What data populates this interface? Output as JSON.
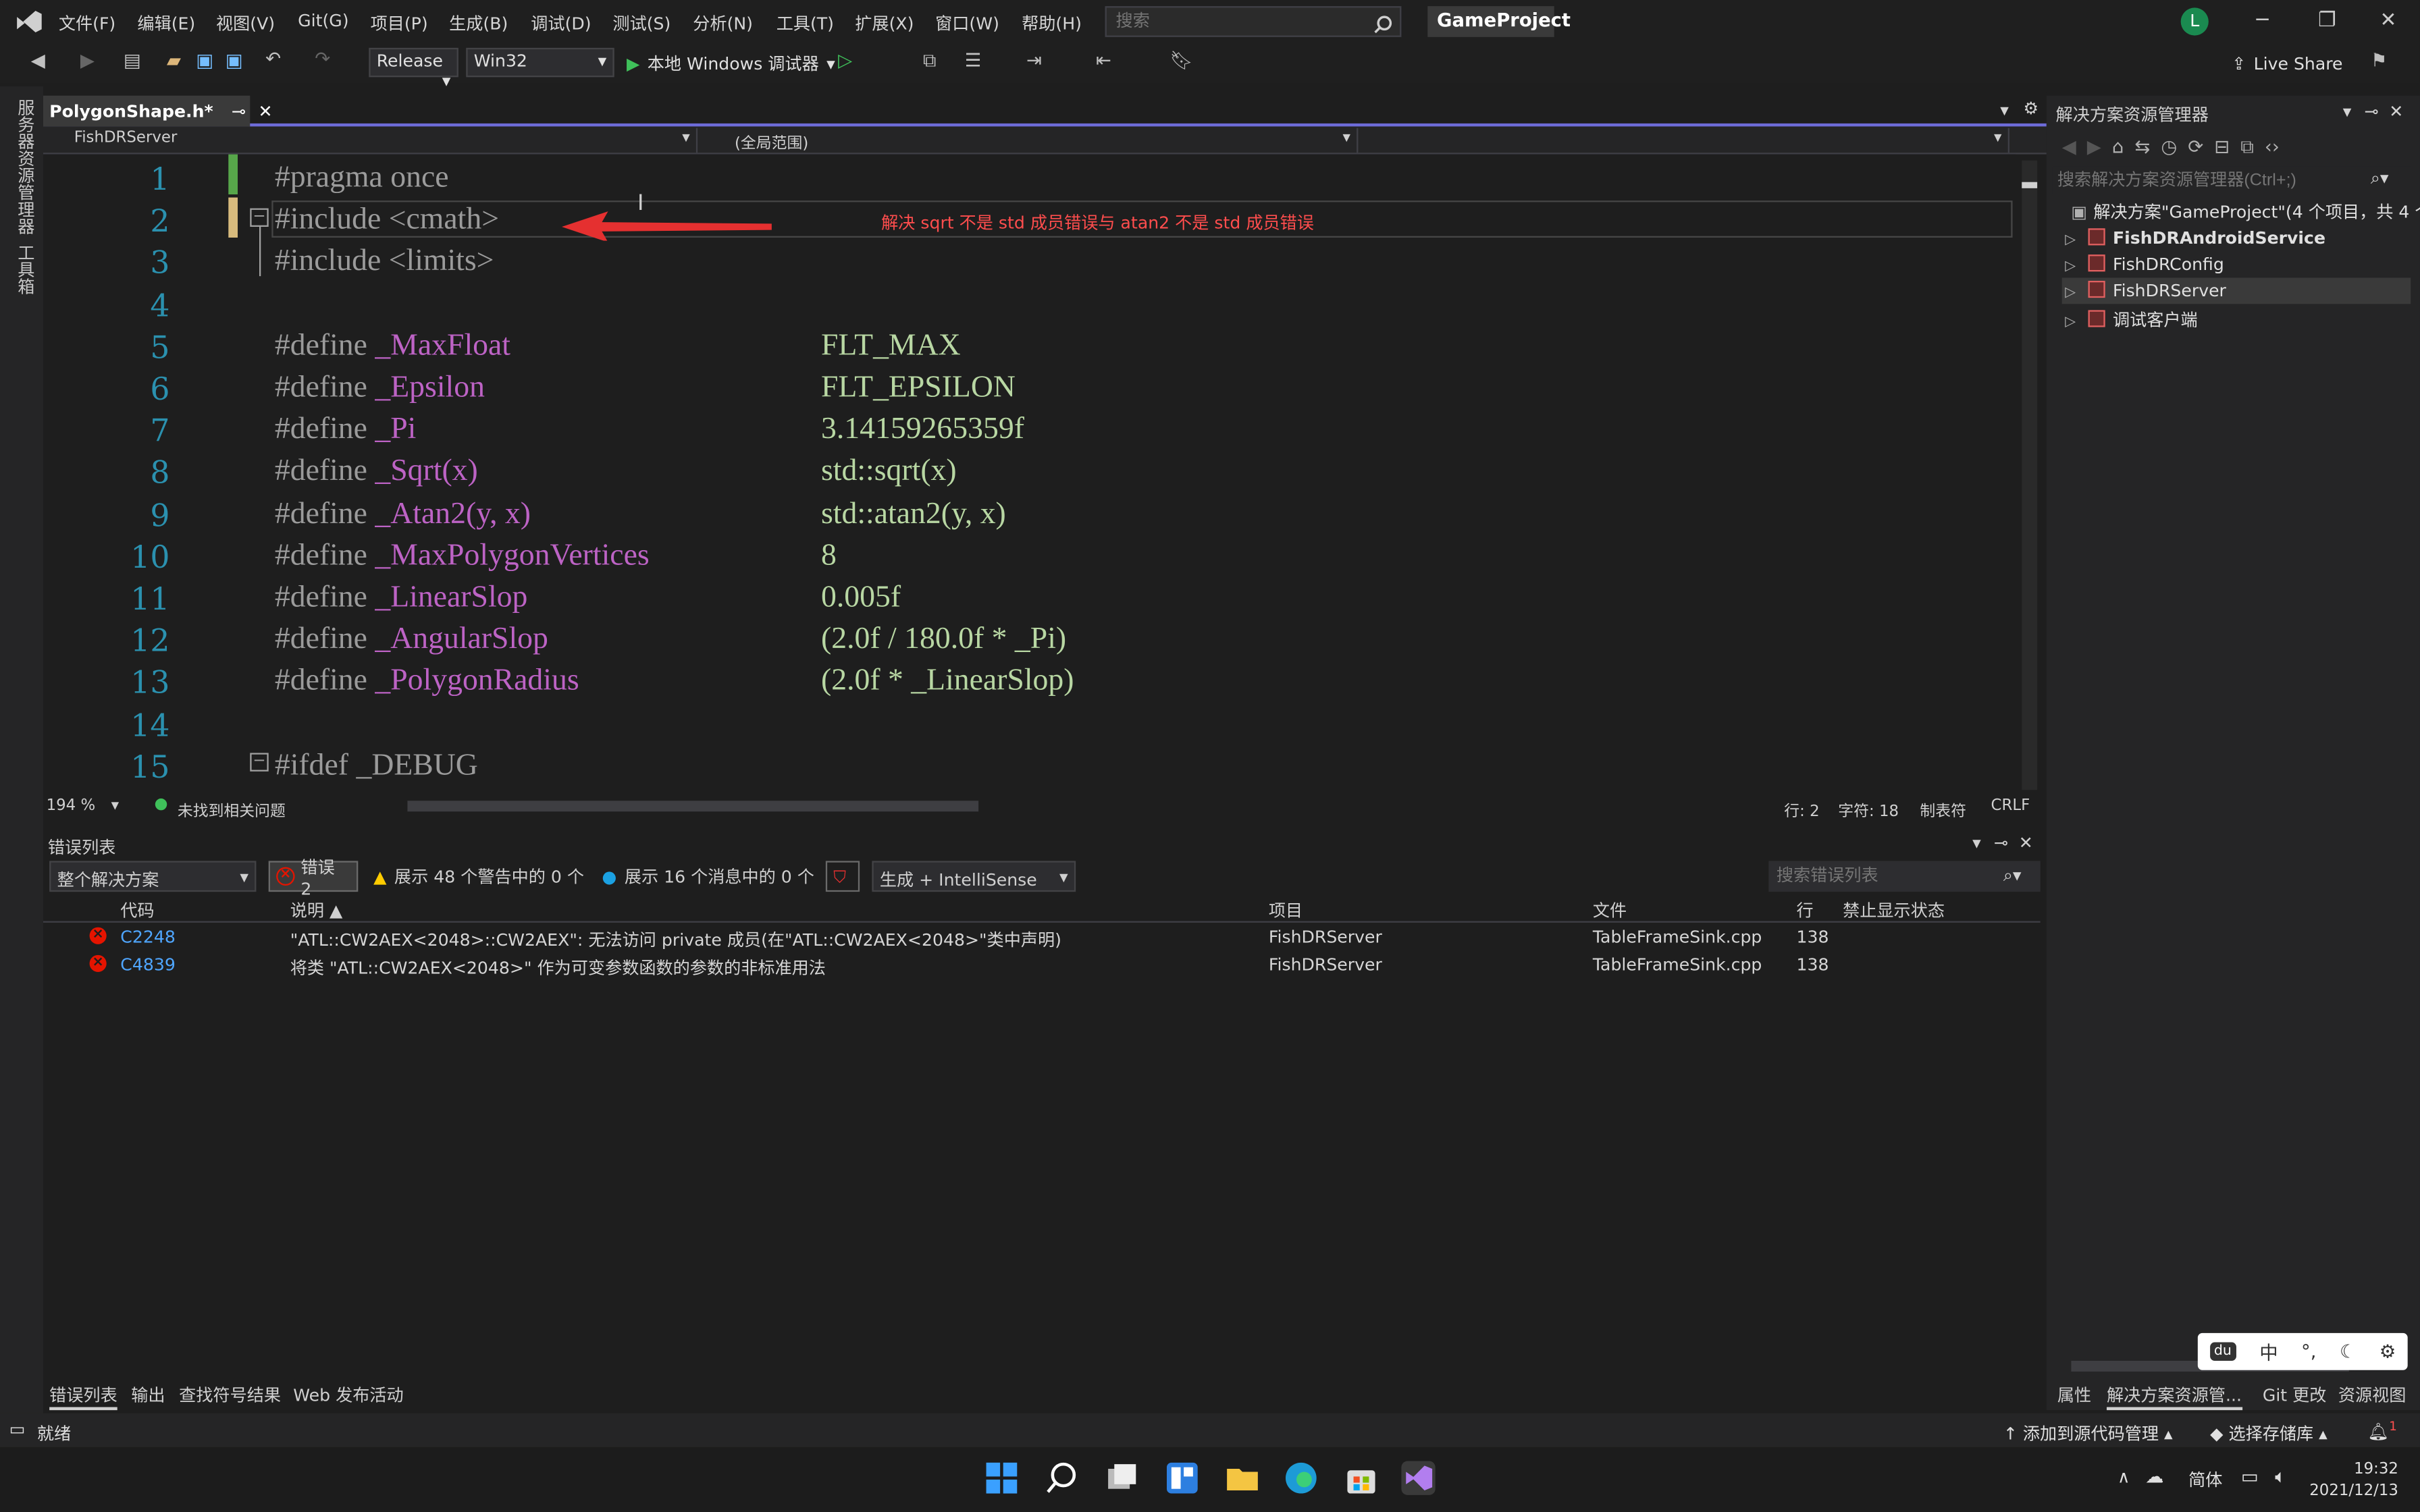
{
  "menu": [
    "文件(F)",
    "编辑(E)",
    "视图(V)",
    "Git(G)",
    "项目(P)",
    "生成(B)",
    "调试(D)",
    "测试(S)",
    "分析(N)",
    "工具(T)",
    "扩展(X)",
    "窗口(W)",
    "帮助(H)"
  ],
  "search_placeholder": "搜索",
  "project_name": "GameProject",
  "avatar_letter": "L",
  "toolbar": {
    "config": "Release",
    "platform": "Win32",
    "debugger": "本地 Windows 调试器",
    "live_share": "Live Share"
  },
  "left_rail": [
    "服务器资源管理器",
    "工具箱"
  ],
  "editor": {
    "tab_title": "PolygonShape.h*",
    "nav_project": "FishDRServer",
    "nav_scope": "(全局范围)",
    "annotation": "解决 sqrt 不是 std 成员错误与 atan2 不是 std 成员错误",
    "lines": [
      {
        "n": "1",
        "a": "#pragma once",
        "b": ""
      },
      {
        "n": "2",
        "a": "#include <cmath>",
        "b": ""
      },
      {
        "n": "3",
        "a": "#include <limits>",
        "b": ""
      },
      {
        "n": "4",
        "a": "",
        "b": ""
      },
      {
        "n": "5",
        "a": "#define _MaxFloat",
        "b": "FLT_MAX"
      },
      {
        "n": "6",
        "a": "#define _Epsilon",
        "b": "FLT_EPSILON"
      },
      {
        "n": "7",
        "a": "#define _Pi",
        "b": "3.14159265359f"
      },
      {
        "n": "8",
        "a": "#define _Sqrt(x)",
        "b": "std::sqrt(x)"
      },
      {
        "n": "9",
        "a": "#define _Atan2(y, x)",
        "b": "std::atan2(y, x)"
      },
      {
        "n": "10",
        "a": "#define _MaxPolygonVertices",
        "b": "8"
      },
      {
        "n": "11",
        "a": "#define _LinearSlop",
        "b": "0.005f"
      },
      {
        "n": "12",
        "a": "#define _AngularSlop",
        "b": "(2.0f / 180.0f * _Pi)"
      },
      {
        "n": "13",
        "a": "#define _PolygonRadius",
        "b": "(2.0f * _LinearSlop)"
      },
      {
        "n": "14",
        "a": "",
        "b": ""
      },
      {
        "n": "15",
        "a": "#ifdef _DEBUG",
        "b": ""
      }
    ],
    "zoom": "194 %",
    "issues": "未找到相关问题",
    "pos_line": "行: 2",
    "pos_char": "字符: 18",
    "tab_mode": "制表符",
    "eol": "CRLF"
  },
  "errors": {
    "title": "错误列表",
    "scope": "整个解决方案",
    "error_count": "错误 2",
    "warnings": "展示 48 个警告中的 0 个",
    "messages": "展示 16 个消息中的 0 个",
    "source": "生成 + IntelliSense",
    "search": "搜索错误列表",
    "headers": {
      "code": "代码",
      "desc": "说明",
      "project": "项目",
      "file": "文件",
      "line": "行",
      "suppress": "禁止显示状态"
    },
    "rows": [
      {
        "code": "C2248",
        "desc": "\"ATL::CW2AEX<2048>::CW2AEX\": 无法访问 private 成员(在\"ATL::CW2AEX<2048>\"类中声明)",
        "project": "FishDRServer",
        "file": "TableFrameSink.cpp",
        "line": "138"
      },
      {
        "code": "C4839",
        "desc": "将类 \"ATL::CW2AEX<2048>\" 作为可变参数函数的参数的非标准用法",
        "project": "FishDRServer",
        "file": "TableFrameSink.cpp",
        "line": "138"
      }
    ],
    "tabs": [
      "错误列表",
      "输出",
      "查找符号结果",
      "Web 发布活动"
    ]
  },
  "solution": {
    "title": "解决方案资源管理器",
    "search": "搜索解决方案资源管理器(Ctrl+;)",
    "root": "解决方案\"GameProject\"(4 个项目，共 4 个",
    "items": [
      "FishDRAndroidService",
      "FishDRConfig",
      "FishDRServer",
      "调试客户端"
    ],
    "tabs": [
      "属性",
      "解决方案资源管...",
      "Git 更改",
      "资源视图"
    ]
  },
  "ime": {
    "lang": "中"
  },
  "status": {
    "ready": "就绪",
    "add_source": "添加到源代码管理",
    "select_repo": "选择存储库",
    "notif": "1"
  },
  "taskbar": {
    "lang": "简体",
    "time": "19:32",
    "date": "2021/12/13"
  }
}
